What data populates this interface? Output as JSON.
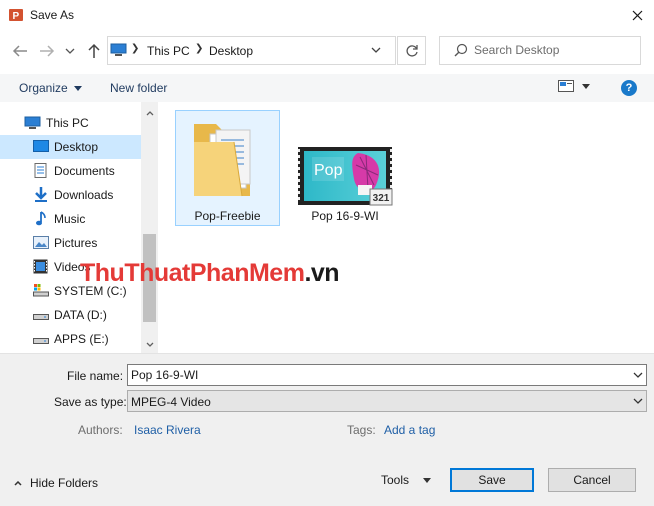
{
  "window": {
    "title": "Save As",
    "app_icon": "powerpoint-icon",
    "close_icon": "close-icon"
  },
  "navigation": {
    "back_icon": "arrow-left-icon",
    "forward_icon": "arrow-right-icon",
    "recent_icon": "chevron-down-icon",
    "up_icon": "arrow-up-icon"
  },
  "address": {
    "segments": [
      "This PC",
      "Desktop"
    ],
    "refresh_icon": "refresh-icon"
  },
  "search": {
    "placeholder": "Search Desktop"
  },
  "toolbar": {
    "organize_label": "Organize",
    "new_folder_label": "New folder",
    "view_icon": "view-options-icon",
    "help_icon": "help-icon"
  },
  "sidebar": {
    "items": [
      {
        "label": "This PC",
        "icon": "computer-icon"
      },
      {
        "label": "Desktop",
        "icon": "desktop-icon",
        "selected": true
      },
      {
        "label": "Documents",
        "icon": "documents-icon"
      },
      {
        "label": "Downloads",
        "icon": "download-icon"
      },
      {
        "label": "Music",
        "icon": "music-icon"
      },
      {
        "label": "Pictures",
        "icon": "pictures-icon"
      },
      {
        "label": "Videos",
        "icon": "video-icon"
      },
      {
        "label": "SYSTEM (C:)",
        "icon": "system-drive-icon"
      },
      {
        "label": "DATA (D:)",
        "icon": "drive-icon"
      },
      {
        "label": "APPS (E:)",
        "icon": "drive-icon"
      }
    ]
  },
  "files": [
    {
      "name": "Pop-Freebie",
      "icon": "folder-icon"
    },
    {
      "name": "Pop 16-9-WI",
      "icon": "video-file-icon",
      "thumb_text": "Pop",
      "badge": "321"
    }
  ],
  "watermark": {
    "part1": "ThuThuat",
    "part2": "PhanMem",
    "part3": ".vn"
  },
  "form": {
    "file_name_label": "File name:",
    "file_name_value": "Pop 16-9-WI",
    "save_as_type_label": "Save as type:",
    "save_as_type_value": "MPEG-4 Video",
    "authors_label": "Authors:",
    "authors_value": "Isaac Rivera",
    "tags_label": "Tags:",
    "tags_value": "Add a tag"
  },
  "footer": {
    "hide_folders_label": "Hide Folders",
    "tools_label": "Tools",
    "save_label": "Save",
    "cancel_label": "Cancel"
  },
  "colors": {
    "accent": "#0078d7",
    "selection": "#cce8ff",
    "link": "#1f5fa6",
    "watermark_red": "#e43a37"
  }
}
